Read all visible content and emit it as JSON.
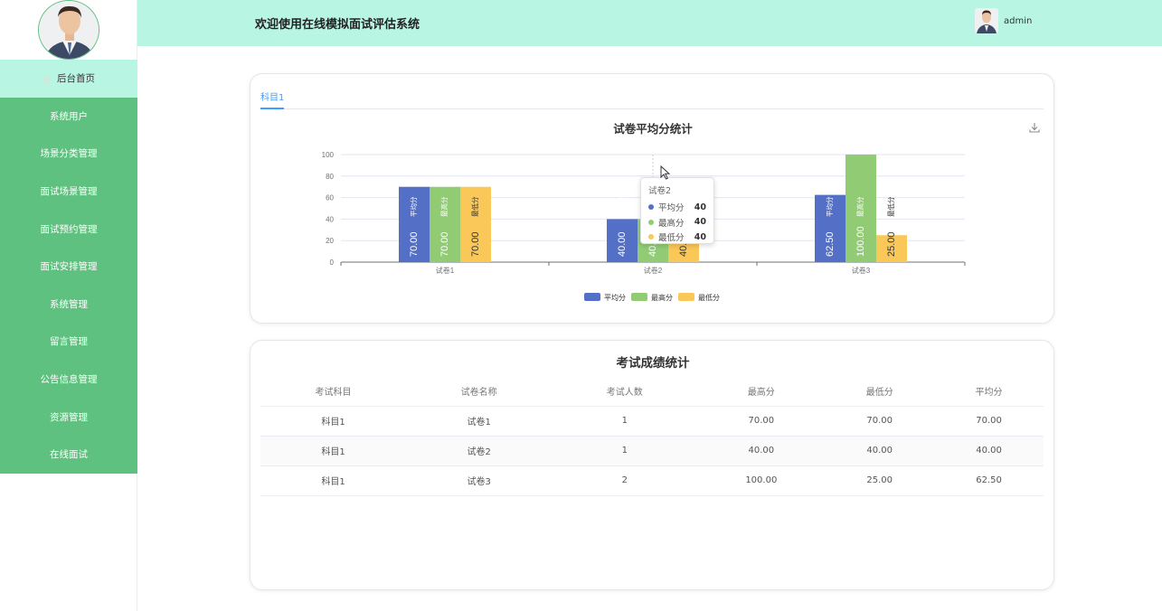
{
  "header": {
    "title": "欢迎使用在线模拟面试评估系统",
    "username": "admin"
  },
  "sidebar": {
    "items": [
      {
        "label": "后台首页",
        "active": true
      },
      {
        "label": "系统用户"
      },
      {
        "label": "场景分类管理"
      },
      {
        "label": "面试场景管理"
      },
      {
        "label": "面试预约管理"
      },
      {
        "label": "面试安排管理"
      },
      {
        "label": "系统管理"
      },
      {
        "label": "留言管理"
      },
      {
        "label": "公告信息管理"
      },
      {
        "label": "资源管理"
      },
      {
        "label": "在线面试"
      }
    ]
  },
  "tabs": [
    {
      "label": "科目1",
      "active": true
    }
  ],
  "chart_data": {
    "type": "bar",
    "title": "试卷平均分统计",
    "categories": [
      "试卷1",
      "试卷2",
      "试卷3"
    ],
    "series": [
      {
        "name": "平均分",
        "color": "#5470c6",
        "values": [
          70.0,
          40.0,
          62.5
        ]
      },
      {
        "name": "最高分",
        "color": "#91cc75",
        "values": [
          70.0,
          40.0,
          100.0
        ]
      },
      {
        "name": "最低分",
        "color": "#fac858",
        "values": [
          70.0,
          40.0,
          25.0
        ]
      }
    ],
    "ylim": [
      0,
      100
    ],
    "yticks": [
      0,
      20,
      40,
      60,
      80,
      100
    ],
    "legend": "bottom-center",
    "grid": true
  },
  "tooltip": {
    "title": "试卷2",
    "rows": [
      {
        "name": "平均分",
        "value": "40",
        "color": "#5470c6"
      },
      {
        "name": "最高分",
        "value": "40",
        "color": "#91cc75"
      },
      {
        "name": "最低分",
        "value": "40",
        "color": "#fac858"
      }
    ]
  },
  "table": {
    "title": "考试成绩统计",
    "columns": [
      "考试科目",
      "试卷名称",
      "考试人数",
      "最高分",
      "最低分",
      "平均分"
    ],
    "rows": [
      [
        "科目1",
        "试卷1",
        "1",
        "70.00",
        "70.00",
        "70.00"
      ],
      [
        "科目1",
        "试卷2",
        "1",
        "40.00",
        "40.00",
        "40.00"
      ],
      [
        "科目1",
        "试卷3",
        "2",
        "100.00",
        "25.00",
        "62.50"
      ]
    ]
  },
  "icons": {
    "download": "download-icon",
    "home": "home-icon",
    "cursor": "mouse-cursor-icon"
  }
}
